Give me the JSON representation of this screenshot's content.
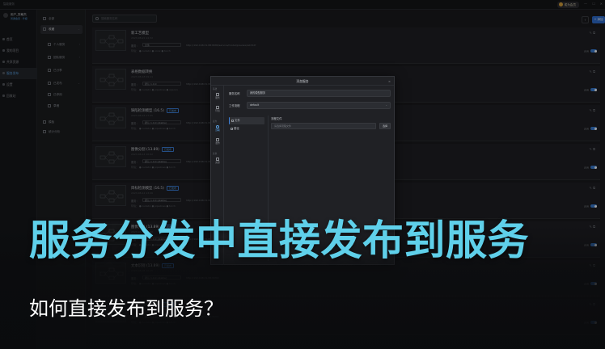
{
  "app": {
    "title": "智能服务"
  },
  "topbar": {
    "vip_label": "成为会员",
    "min": "—",
    "max": "☐",
    "close": "✕"
  },
  "sidebar": {
    "user_name": "用户_张敏杰",
    "user_sub": "普通会员 · 升级",
    "items": [
      {
        "label": "首页"
      },
      {
        "label": "我的项目"
      },
      {
        "label": "共享资源"
      },
      {
        "label": "服务发布"
      },
      {
        "label": "设置"
      },
      {
        "label": "回收站"
      }
    ],
    "active_index": 3
  },
  "subnav": {
    "items": [
      {
        "label": "全部"
      },
      {
        "label": "收藏"
      },
      {
        "label": "个人服务"
      },
      {
        "label": "团队服务"
      },
      {
        "label": "已分享"
      },
      {
        "label": "已发布"
      },
      {
        "label": "已停用"
      },
      {
        "label": "草稿"
      },
      {
        "label": "模板"
      },
      {
        "label": "统计分析"
      }
    ],
    "active_index": 1
  },
  "main": {
    "search_placeholder": "搜索服务名称",
    "add_label": "+ 添加",
    "cards": [
      {
        "title": "新工艺模型",
        "tag": "",
        "date": "2023-08-21 14:32",
        "svc_label": "服务：",
        "svc_value": "文件",
        "url": "http://192.168.31.88:8080/service/model/preview/ab7d2f",
        "env": "环境： ● cuda11  ● onnx  ● torch",
        "switch_label": "启用"
      },
      {
        "title": "表格数据转换",
        "tag": "",
        "date": "2023-08-18 09:11",
        "svc_label": "服务：",
        "svc_value": "默认 1.0.0",
        "url": "http://192.168.31.88:8080/",
        "env": "环境： ● cuda11  ● pipelines  ● opencv",
        "switch_label": "启用"
      },
      {
        "title": "缺陷检测模型 (16.5)",
        "tag": "已发布",
        "date": "2023-08-16 17:45",
        "svc_label": "服务：",
        "svc_value": "默认 1.0.0 (stable)",
        "url": "http://192.168.31.88:8080/",
        "env": "环境： ● cuda11  ● pipelines  ● torch",
        "switch_label": "启用"
      },
      {
        "title": "图像分割 (13.89)",
        "tag": "已发布",
        "date": "2023-08-14 10:02",
        "svc_label": "服务：",
        "svc_value": "默认 1.0.0 (stable)",
        "url": "http://192.168.31.88:8080/",
        "env": "环境： ● cuda11  ● pipelines  ● torch",
        "switch_label": "启用"
      },
      {
        "title": "目标检测模型 (16.5)",
        "tag": "已发布",
        "date": "2023-08-12 13:26",
        "svc_label": "服务：",
        "svc_value": "默认 1.0.0 (stable)",
        "url": "http://192.168.31.88:8080/",
        "env": "环境： ● cuda11  ● pipelines  ● torch",
        "switch_label": "启用"
      },
      {
        "title": "图像分类 (13.89)",
        "tag": "已发布",
        "date": "2023-08-10 08:40",
        "svc_label": "服务：",
        "svc_value": "默认 1.0.0 (stable)",
        "url": "http://192.168.31.88:8080/",
        "env": "环境： ● cuda11  ● pipelines  ● torch",
        "switch_label": "启用"
      },
      {
        "title": "文本识别 (13.89)",
        "tag": "已发布",
        "date": "2023-08-08 16:15",
        "svc_label": "服务：",
        "svc_value": "默认 1.0.0 (stable)",
        "url": "http://192.168.31.88:8080/",
        "env": "环境： ● cuda11  ● pipelines  ● torch",
        "switch_label": "启用"
      },
      {
        "title": "语音识别 (13.89)",
        "tag": "已发布",
        "date": "2023-08-05 11:58",
        "svc_label": "服务：",
        "svc_value": "默认 1.0.0 (stable)",
        "url": "http://192.168.31.88:8080/",
        "env": "环境： ● cuda11  ● pipelines  ● torch",
        "switch_label": "启用"
      }
    ]
  },
  "modal": {
    "title": "添加服务",
    "close": "×",
    "left_groups": [
      "基础",
      "发布",
      "其他"
    ],
    "left_tabs": [
      {
        "label": "服务"
      },
      {
        "label": "环境"
      },
      {
        "label": "部署"
      },
      {
        "label": "发布"
      },
      {
        "label": "资源"
      }
    ],
    "active_tab_index": 2,
    "service_name_label": "服务名称",
    "service_name_value": "我的模型服务",
    "workflow_label": "工作流程",
    "workflow_value": "default",
    "workflow_dropdown": "⌄",
    "list": [
      {
        "label": "文件"
      },
      {
        "label": "路径"
      }
    ],
    "file_label": "流程文件",
    "file_placeholder": "请选择流程文件",
    "pick_label": "选择"
  },
  "overlay": {
    "headline": "服务分发中直接发布到服务",
    "subline": "如何直接发布到服务？"
  },
  "colors": {
    "accent": "#5fd0ea",
    "primary": "#2f6fd1",
    "bg": "#1a1b1e"
  }
}
